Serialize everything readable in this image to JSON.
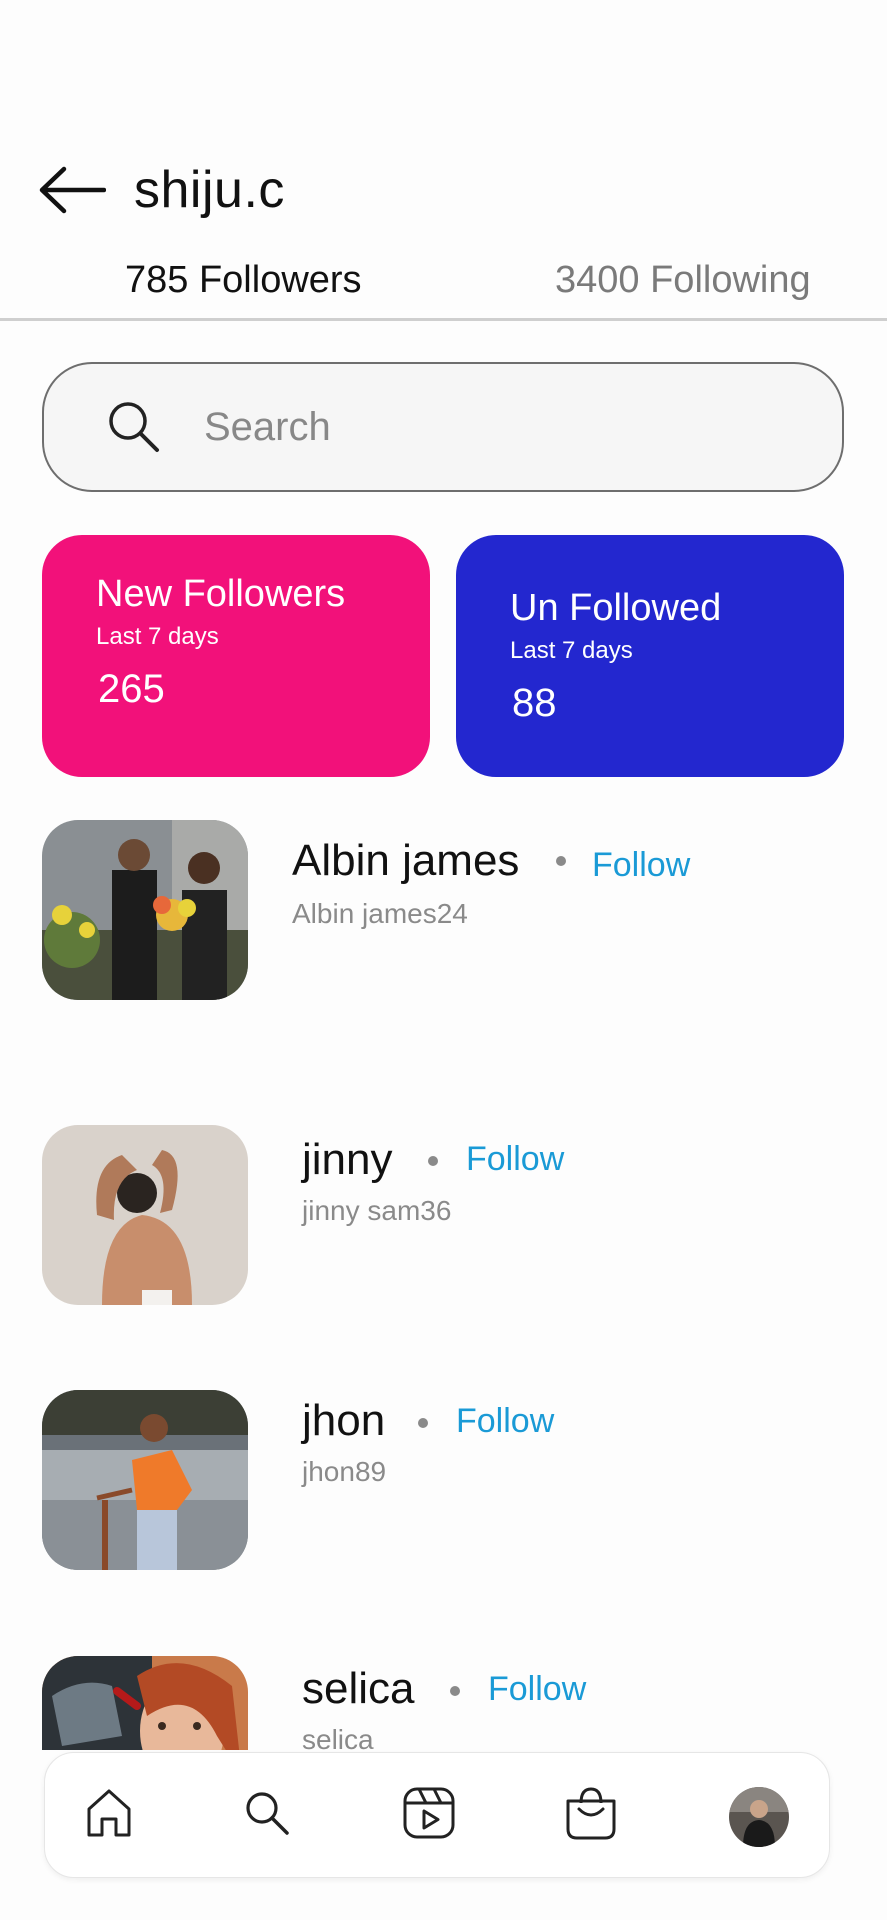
{
  "header": {
    "title": "shiju.c"
  },
  "tabs": {
    "followers": "785 Followers",
    "following": "3400 Following"
  },
  "search": {
    "placeholder": "Search"
  },
  "cards": {
    "new_followers": {
      "title": "New Followers",
      "subtitle": "Last 7 days",
      "value": "265"
    },
    "unfollowed": {
      "title": "Un Followed",
      "subtitle": "Last 7 days",
      "value": "88"
    }
  },
  "users": [
    {
      "name": "Albin james",
      "handle": "Albin james24",
      "action": "Follow"
    },
    {
      "name": "jinny",
      "handle": "jinny sam36",
      "action": "Follow"
    },
    {
      "name": "jhon",
      "handle": "jhon89",
      "action": "Follow"
    },
    {
      "name": "selica",
      "handle": "selica",
      "action": "Follow"
    }
  ],
  "colors": {
    "pink": "#f2117a",
    "blue": "#2327cf",
    "follow": "#1a9ad6"
  },
  "icons": [
    "arrow-left-icon",
    "search-icon",
    "home-icon",
    "reels-icon",
    "shop-icon"
  ]
}
